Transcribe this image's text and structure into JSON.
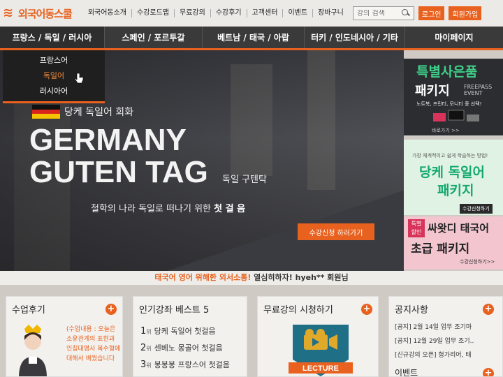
{
  "header": {
    "logo_text": "외국어동스쿨",
    "nav": [
      "외국어동소개",
      "수강로드맵",
      "무료강의",
      "수강후기",
      "고객센터",
      "이벤트",
      "장바구니"
    ],
    "search_placeholder": "강의 검색",
    "login_label": "로그인",
    "join_label": "회원가입"
  },
  "mainnav": {
    "items": [
      "프랑스 / 독일 / 러시아",
      "스페인 / 포르투갈",
      "베트남 / 태국 / 아랍",
      "터키 / 인도네시아 / 기타",
      "마이페이지"
    ]
  },
  "dropdown": {
    "options": [
      "프랑스어",
      "독일어",
      "러시아어"
    ]
  },
  "hero": {
    "kicker": "당케 독일어 회화",
    "line1": "GERMANY",
    "line2": "GUTEN TAG",
    "line2_sub": "독일 구텐탁",
    "desc_prefix": "철학의 나라 독일로 떠나기 위한 ",
    "desc_bold": "첫 걸 음",
    "cta": "수강신청 하러가기"
  },
  "banners": {
    "b1_title": "특별사은품",
    "b1_sub": "패키지",
    "b1_tag1": "FREEPASS",
    "b1_tag2": "EVENT",
    "b1_desc": "노트북, 프린터, 모니터 중 선택!",
    "b1_more": "바로가기 >>",
    "b2_kicker": "가장 체계적이고 쉽게 학습하는 방법!",
    "b2_line1": "당케 독일어",
    "b2_line2": "패키지",
    "b2_apply": "수강신청하기",
    "b3_tag1": "특별",
    "b3_tag2": "할인",
    "b3_line1": "싸왓디 태국어",
    "b3_line2": "초급 패키지",
    "b3_apply": "수강신청하기>>"
  },
  "ticker": {
    "highlight": "태국어 영어 위해한 외서소통!",
    "message": " 열심히하자! hyeh** 회원님"
  },
  "panels": {
    "reviews": {
      "title": "수업후기",
      "text": "(수업내용 : 오늘은 소유관계의 표현과 인칭대명사 복수형에 대해서 배웠습니다"
    },
    "best": {
      "title": "인기강좌 베스트 5",
      "rank_suffix": "위",
      "items": [
        {
          "rank": "1",
          "name": "당케 독일어 첫걸음"
        },
        {
          "rank": "2",
          "name": "센베노 몽골어 첫걸음"
        },
        {
          "rank": "3",
          "name": "봉봉봉 프랑스어 첫걸음"
        }
      ]
    },
    "free": {
      "title": "무료강의 시청하기",
      "badge": "LECTURE"
    },
    "notice": {
      "title": "공지사항",
      "items": [
        "[공지] 2월 14일 업무 조기마",
        "[공지] 12월 29일 업무 조기..",
        "[신규강의 오픈] 헝가리어, 태"
      ],
      "sub_title": "이벤트"
    }
  },
  "colors": {
    "accent": "#e8611e",
    "nav_bg": "#3a3a3a",
    "green": "#12a870"
  }
}
